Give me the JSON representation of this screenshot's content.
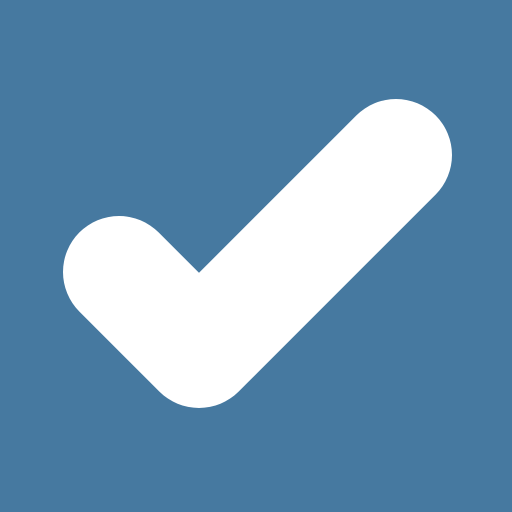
{
  "icon": {
    "name": "checkmark-icon",
    "background_color": "#4679A0",
    "foreground_color": "#FFFFFF"
  }
}
